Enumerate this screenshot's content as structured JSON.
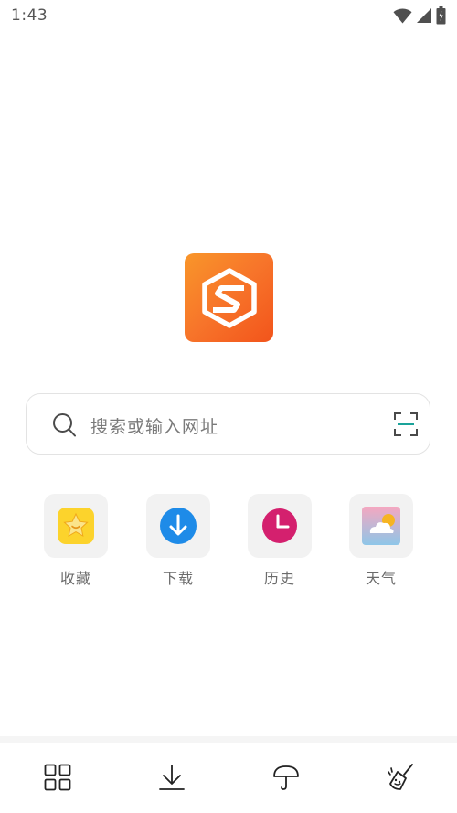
{
  "status_bar": {
    "time": "1:43",
    "icons": [
      "wifi-icon",
      "signal-icon",
      "battery-charging-icon"
    ]
  },
  "logo": {
    "icon": "browser-s-logo",
    "colors": [
      "#f9962a",
      "#f2541b"
    ]
  },
  "search": {
    "placeholder": "搜索或输入网址",
    "left_icon": "search-icon",
    "right_icon": "scan-icon",
    "accent": "#1aa39a"
  },
  "shortcuts": [
    {
      "label": "收藏",
      "icon": "favorites-star-icon",
      "color": "#fcd32c"
    },
    {
      "label": "下载",
      "icon": "download-arrow-icon",
      "color": "#1e8be8"
    },
    {
      "label": "历史",
      "icon": "history-clock-icon",
      "color": "#d4206e"
    },
    {
      "label": "天气",
      "icon": "weather-cloud-icon",
      "color": "#8ec6e8"
    }
  ],
  "bottom_nav": [
    {
      "icon": "grid-menu-icon"
    },
    {
      "icon": "download-icon"
    },
    {
      "icon": "umbrella-icon"
    },
    {
      "icon": "broom-clean-icon"
    }
  ]
}
